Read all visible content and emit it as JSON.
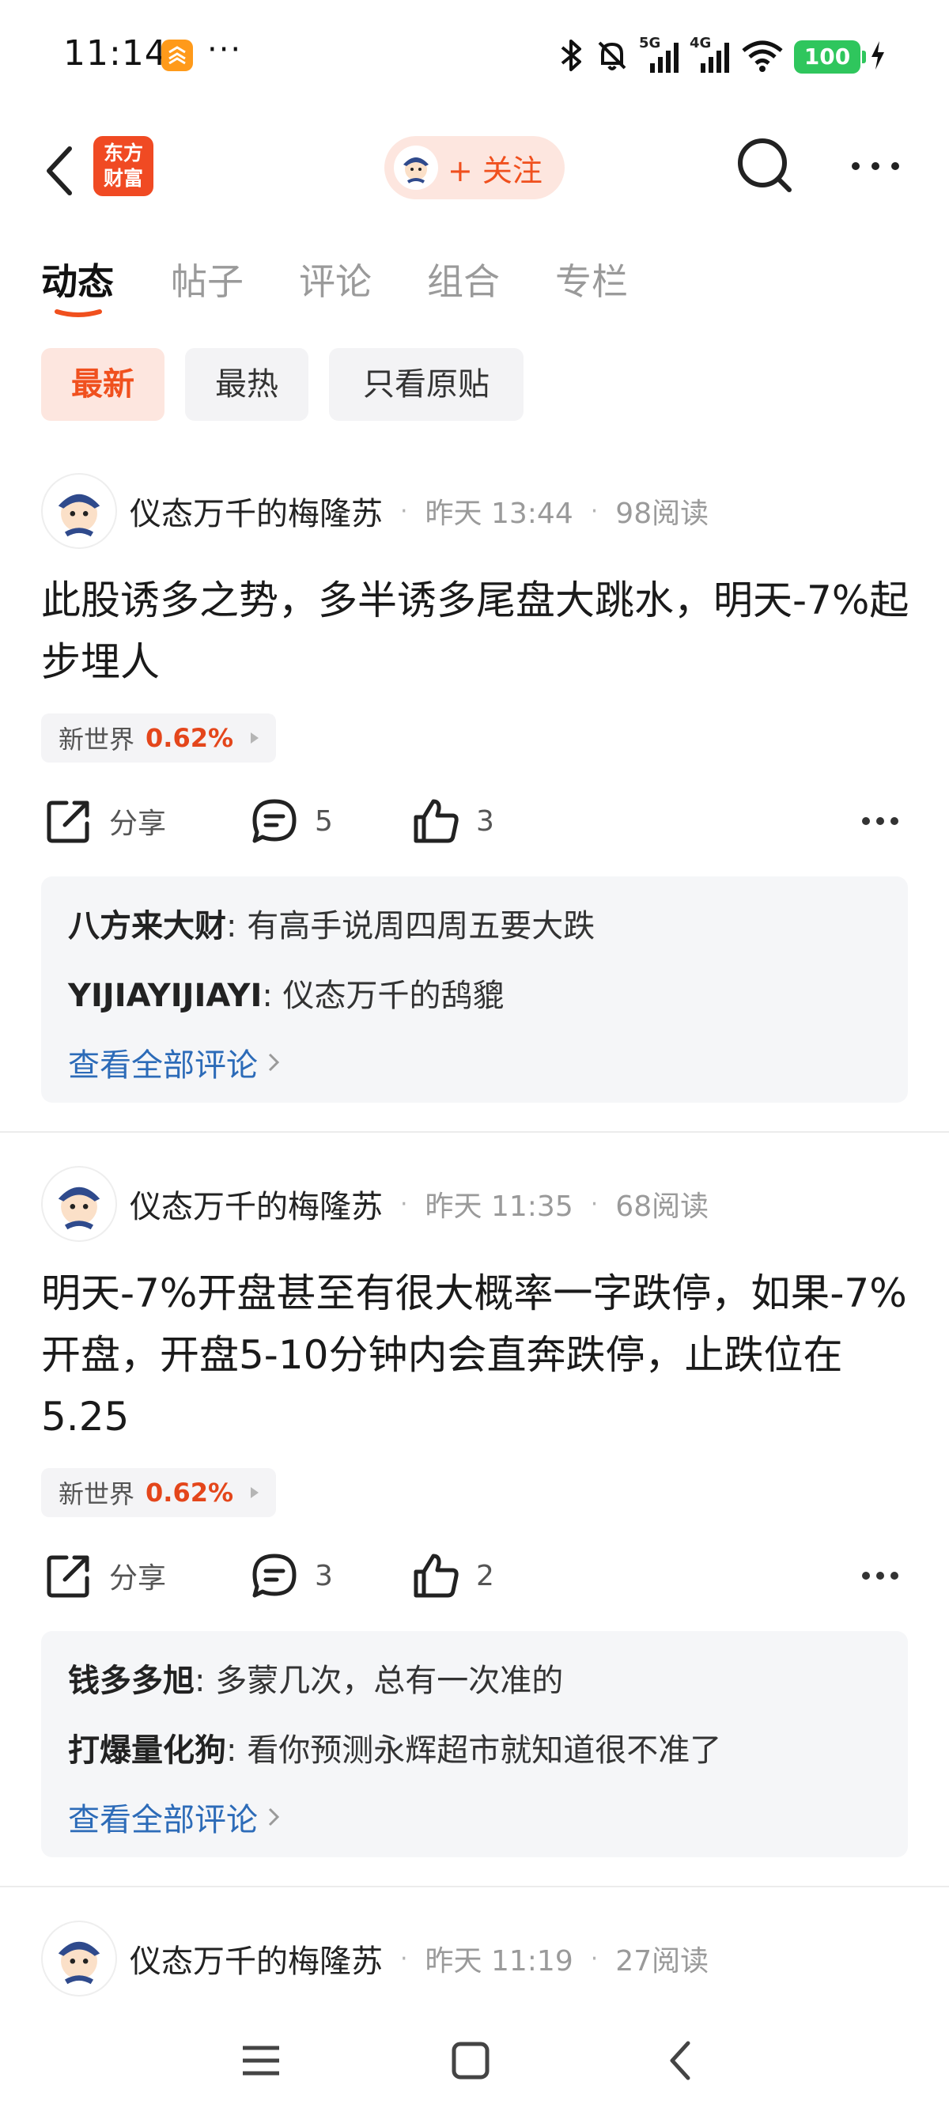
{
  "status_bar": {
    "time": "11:14",
    "more": "···",
    "signal_1": "5G",
    "signal_2": "4G",
    "battery": "100"
  },
  "header": {
    "brand_logo_line1": "东方",
    "brand_logo_line2": "财富",
    "follow_label": "+ 关注"
  },
  "tabs": [
    {
      "label": "动态",
      "active": true
    },
    {
      "label": "帖子",
      "active": false
    },
    {
      "label": "评论",
      "active": false
    },
    {
      "label": "组合",
      "active": false
    },
    {
      "label": "专栏",
      "active": false
    }
  ],
  "filters": [
    {
      "label": "最新",
      "active": true
    },
    {
      "label": "最热",
      "active": false
    },
    {
      "label": "只看原贴",
      "active": false
    }
  ],
  "posts": [
    {
      "author": "仪态万千的梅隆苏",
      "time": "昨天 13:44",
      "reads": "98阅读",
      "text": "此股诱多之势，多半诱多尾盘大跳水，明天-7%起步埋人",
      "stock_name": "新世界",
      "stock_change": "0.62%",
      "share_label": "分享",
      "comment_count": "5",
      "like_count": "3",
      "comments": [
        {
          "user": "八方来大财",
          "sep": ": ",
          "text": "有高手说周四周五要大跌"
        },
        {
          "user": "YIJIAYIJIAYI",
          "sep": ": ",
          "text": "仪态万千的鸹貔"
        }
      ],
      "view_all": "查看全部评论"
    },
    {
      "author": "仪态万千的梅隆苏",
      "time": "昨天 11:35",
      "reads": "68阅读",
      "text": "明天-7%开盘甚至有很大概率一字跌停，如果-7%开盘，开盘5-10分钟内会直奔跌停，止跌位在5.25",
      "stock_name": "新世界",
      "stock_change": "0.62%",
      "share_label": "分享",
      "comment_count": "3",
      "like_count": "2",
      "comments": [
        {
          "user": "钱多多旭",
          "sep": ": ",
          "text": "多蒙几次，总有一次准的"
        },
        {
          "user": "打爆量化狗",
          "sep": ": ",
          "text": "看你预测永辉超市就知道很不准了"
        }
      ],
      "view_all": "查看全部评论"
    },
    {
      "author": "仪态万千的梅隆苏",
      "time": "昨天 11:19",
      "reads": "27阅读"
    }
  ],
  "colors": {
    "accent": "#f0501e",
    "link": "#2c6bb8",
    "battery": "#2fc65d",
    "chip_active_bg": "#fde6df"
  },
  "icons": {
    "back": "chevron-left-icon",
    "search": "search-icon",
    "more": "more-horizontal-icon",
    "share": "share-icon",
    "comment": "comment-icon",
    "like": "thumbs-up-icon"
  }
}
